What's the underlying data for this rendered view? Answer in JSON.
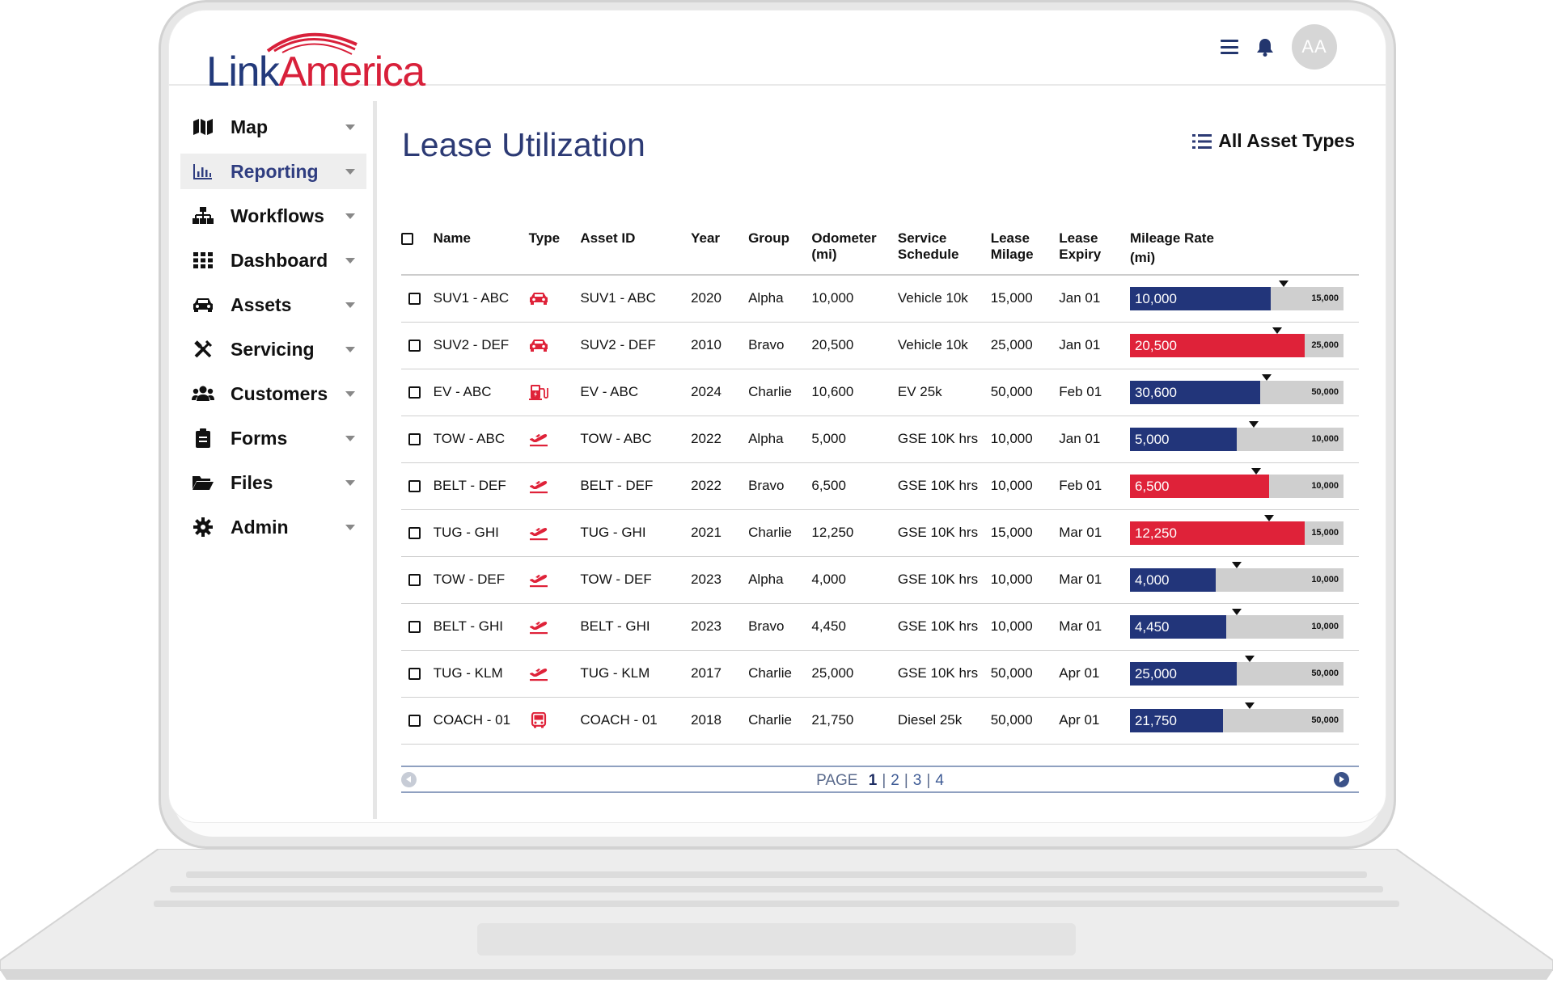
{
  "brand": {
    "logo_part1": "Link",
    "logo_part2": "America"
  },
  "header": {
    "avatar_initials": "AA",
    "icons": [
      "menu-icon",
      "bell-icon"
    ]
  },
  "sidebar": {
    "items": [
      {
        "label": "Map",
        "icon": "map-icon"
      },
      {
        "label": "Reporting",
        "icon": "chart-icon",
        "active": true
      },
      {
        "label": "Workflows",
        "icon": "sitemap-icon"
      },
      {
        "label": "Dashboard",
        "icon": "grid-icon"
      },
      {
        "label": "Assets",
        "icon": "car-icon"
      },
      {
        "label": "Servicing",
        "icon": "tools-icon"
      },
      {
        "label": "Customers",
        "icon": "users-icon"
      },
      {
        "label": "Forms",
        "icon": "clipboard-icon"
      },
      {
        "label": "Files",
        "icon": "folder-icon"
      },
      {
        "label": "Admin",
        "icon": "gear-icon"
      }
    ]
  },
  "main": {
    "title": "Lease Utilization",
    "asset_filter": "All Asset Types"
  },
  "table": {
    "headers": {
      "name": "Name",
      "type": "Type",
      "asset_id": "Asset ID",
      "year": "Year",
      "group": "Group",
      "odometer_1": "Odometer",
      "odometer_2": "(mi)",
      "service_1": "Service",
      "service_2": "Schedule",
      "lease_mil_1": "Lease",
      "lease_mil_2": "Milage",
      "lease_exp_1": "Lease",
      "lease_exp_2": "Expiry",
      "rate_1": "Mileage Rate",
      "rate_2": "(mi)"
    },
    "rows": [
      {
        "name": "SUV1 - ABC",
        "type": "car",
        "asset_id": "SUV1 - ABC",
        "year": "2020",
        "group": "Alpha",
        "odometer": "10,000",
        "service": "Vehicle 10k",
        "lease_milage": "15,000",
        "lease_expiry": "Jan 01",
        "rate_value": "10,000",
        "rate_max": "15,000",
        "fill_fraction": 0.66,
        "marker_fraction": 0.72,
        "status": "blue"
      },
      {
        "name": "SUV2 - DEF",
        "type": "car",
        "asset_id": "SUV2 - DEF",
        "year": "2010",
        "group": "Bravo",
        "odometer": "20,500",
        "service": "Vehicle 10k",
        "lease_milage": "25,000",
        "lease_expiry": "Jan 01",
        "rate_value": "20,500",
        "rate_max": "25,000",
        "fill_fraction": 0.82,
        "marker_fraction": 0.69,
        "status": "red"
      },
      {
        "name": "EV - ABC",
        "type": "ev",
        "asset_id": "EV - ABC",
        "year": "2024",
        "group": "Charlie",
        "odometer": "10,600",
        "service": "EV 25k",
        "lease_milage": "50,000",
        "lease_expiry": "Feb 01",
        "rate_value": "30,600",
        "rate_max": "50,000",
        "fill_fraction": 0.61,
        "marker_fraction": 0.64,
        "status": "blue"
      },
      {
        "name": "TOW - ABC",
        "type": "plane",
        "asset_id": "TOW - ABC",
        "year": "2022",
        "group": "Alpha",
        "odometer": "5,000",
        "service": "GSE 10K hrs",
        "lease_milage": "10,000",
        "lease_expiry": "Jan 01",
        "rate_value": "5,000",
        "rate_max": "10,000",
        "fill_fraction": 0.5,
        "marker_fraction": 0.58,
        "status": "blue"
      },
      {
        "name": "BELT - DEF",
        "type": "plane",
        "asset_id": "BELT - DEF",
        "year": "2022",
        "group": "Bravo",
        "odometer": "6,500",
        "service": "GSE 10K hrs",
        "lease_milage": "10,000",
        "lease_expiry": "Feb 01",
        "rate_value": "6,500",
        "rate_max": "10,000",
        "fill_fraction": 0.65,
        "marker_fraction": 0.59,
        "status": "red"
      },
      {
        "name": "TUG - GHI",
        "type": "plane",
        "asset_id": "TUG - GHI",
        "year": "2021",
        "group": "Charlie",
        "odometer": "12,250",
        "service": "GSE 10K hrs",
        "lease_milage": "15,000",
        "lease_expiry": "Mar 01",
        "rate_value": "12,250",
        "rate_max": "15,000",
        "fill_fraction": 0.82,
        "marker_fraction": 0.65,
        "status": "red"
      },
      {
        "name": "TOW - DEF",
        "type": "plane",
        "asset_id": "TOW - DEF",
        "year": "2023",
        "group": "Alpha",
        "odometer": "4,000",
        "service": "GSE 10K hrs",
        "lease_milage": "10,000",
        "lease_expiry": "Mar 01",
        "rate_value": "4,000",
        "rate_max": "10,000",
        "fill_fraction": 0.4,
        "marker_fraction": 0.5,
        "status": "blue"
      },
      {
        "name": "BELT - GHI",
        "type": "plane",
        "asset_id": "BELT - GHI",
        "year": "2023",
        "group": "Bravo",
        "odometer": "4,450",
        "service": "GSE 10K hrs",
        "lease_milage": "10,000",
        "lease_expiry": "Mar 01",
        "rate_value": "4,450",
        "rate_max": "10,000",
        "fill_fraction": 0.45,
        "marker_fraction": 0.5,
        "status": "blue"
      },
      {
        "name": "TUG - KLM",
        "type": "plane",
        "asset_id": "TUG - KLM",
        "year": "2017",
        "group": "Charlie",
        "odometer": "25,000",
        "service": "GSE 10K hrs",
        "lease_milage": "50,000",
        "lease_expiry": "Apr 01",
        "rate_value": "25,000",
        "rate_max": "50,000",
        "fill_fraction": 0.5,
        "marker_fraction": 0.56,
        "status": "blue"
      },
      {
        "name": "COACH - 01",
        "type": "bus",
        "asset_id": "COACH - 01",
        "year": "2018",
        "group": "Charlie",
        "odometer": "21,750",
        "service": "Diesel 25k",
        "lease_milage": "50,000",
        "lease_expiry": "Apr 01",
        "rate_value": "21,750",
        "rate_max": "50,000",
        "fill_fraction": 0.435,
        "marker_fraction": 0.56,
        "status": "blue"
      }
    ]
  },
  "pager": {
    "prefix": "PAGE",
    "pages": [
      "1",
      "2",
      "3",
      "4"
    ],
    "current": "1"
  },
  "colors": {
    "navy": "#22357a",
    "red": "#df2239",
    "title": "#2c3a74"
  }
}
